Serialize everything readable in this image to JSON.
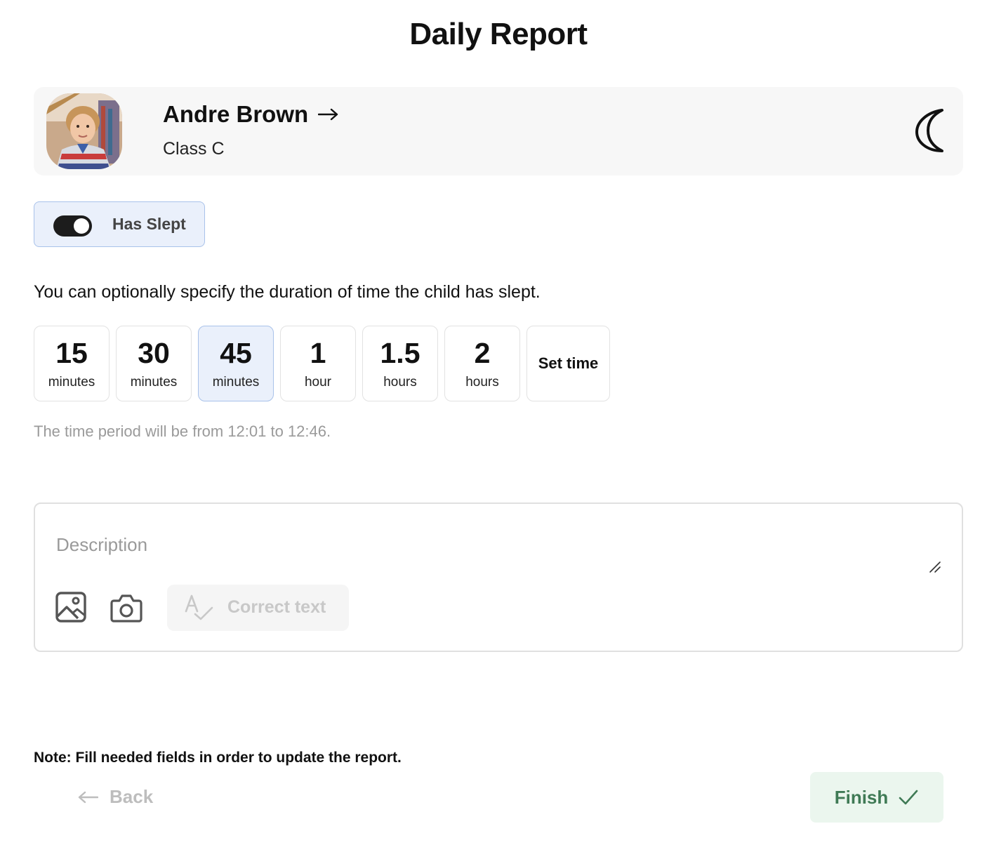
{
  "header": {
    "title": "Daily Report"
  },
  "child": {
    "name": "Andre Brown",
    "class_label": "Class C",
    "avatar_icon": "child-photo",
    "name_arrow_icon": "arrow-right-icon",
    "status_icon": "moon-icon"
  },
  "toggle": {
    "label": "Has Slept",
    "on": true
  },
  "hint": "You can optionally specify the duration of time the child has slept.",
  "durations": [
    {
      "value": "15",
      "unit": "minutes",
      "selected": false
    },
    {
      "value": "30",
      "unit": "minutes",
      "selected": false
    },
    {
      "value": "45",
      "unit": "minutes",
      "selected": true
    },
    {
      "value": "1",
      "unit": "hour",
      "selected": false
    },
    {
      "value": "1.5",
      "unit": "hours",
      "selected": false
    },
    {
      "value": "2",
      "unit": "hours",
      "selected": false
    }
  ],
  "set_time_label": "Set time",
  "period_text": "The time period will be from 12:01 to 12:46.",
  "description": {
    "placeholder": "Description",
    "value": "",
    "correct_text_label": "Correct text"
  },
  "note": "Note: Fill needed fields in order to update the report.",
  "footer": {
    "back_label": "Back",
    "finish_label": "Finish"
  },
  "colors": {
    "selected_bg": "#eaf0fb",
    "selected_border": "#a9c2ea",
    "finish_bg": "#ebf6ee",
    "finish_text": "#3f7a55"
  }
}
